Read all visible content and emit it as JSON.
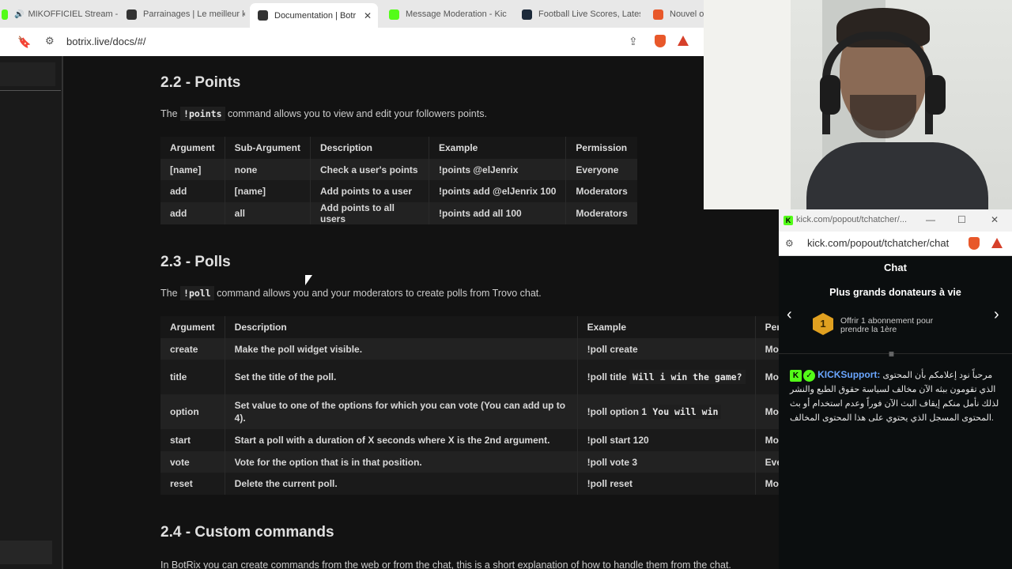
{
  "browser": {
    "tabs": [
      {
        "label": "MIKOFFICIEL Stream -",
        "active": false,
        "favicon_color": "#53fc18"
      },
      {
        "label": "Parrainages | Le meilleur k",
        "active": false,
        "favicon_color": "#333333"
      },
      {
        "label": "Documentation | Botr",
        "active": true,
        "favicon_color": "#333333"
      },
      {
        "label": "Message Moderation - Kic",
        "active": false,
        "favicon_color": "#53fc18"
      },
      {
        "label": "Football Live Scores, Lates",
        "active": false,
        "favicon_color": "#1c2a3a"
      },
      {
        "label": "Nouvel o",
        "active": false,
        "favicon_color": "#e8582a"
      }
    ],
    "close_glyph": "✕",
    "url": "botrix.live/docs/#/",
    "brave_badge": "1"
  },
  "docs": {
    "points": {
      "title": "2.2 - Points",
      "intro_before": "The",
      "intro_code": "!points",
      "intro_after": "command allows you to view and edit your followers points.",
      "headers": [
        "Argument",
        "Sub-Argument",
        "Description",
        "Example",
        "Permission"
      ],
      "rows": [
        [
          "[name]",
          "none",
          "Check a user's points",
          "!points @elJenrix",
          "Everyone"
        ],
        [
          "add",
          "[name]",
          "Add points to a user",
          "!points add @elJenrix 100",
          "Moderators"
        ],
        [
          "add",
          "all",
          "Add points to all users",
          "!points add all 100",
          "Moderators"
        ]
      ]
    },
    "polls": {
      "title": "2.3 - Polls",
      "intro_before": "The",
      "intro_code": "!poll",
      "intro_after": "command allows you and your moderators to create polls from Trovo chat.",
      "headers": [
        "Argument",
        "Description",
        "Example",
        "Per"
      ],
      "rows": [
        {
          "arg": "create",
          "desc": "Make the poll widget visible.",
          "ex": "!poll create",
          "ex_code": "",
          "perm": "Mo"
        },
        {
          "arg": "title",
          "desc": "Set the title of the poll.",
          "ex": "!poll title",
          "ex_code": "Will i win the game?",
          "perm": "Mo"
        },
        {
          "arg": "option",
          "desc": "Set value to one of the options for which you can vote (You can add up to 4).",
          "ex": "!poll option 1",
          "ex_code": "You will win",
          "perm": "Mo"
        },
        {
          "arg": "start",
          "desc": "Start a poll with a duration of X seconds where X is the 2nd argument.",
          "ex": "!poll start 120",
          "ex_code": "",
          "perm": "Mo"
        },
        {
          "arg": "vote",
          "desc": "Vote for the option that is in that position.",
          "ex": "!poll vote 3",
          "ex_code": "",
          "perm": "Eve"
        },
        {
          "arg": "reset",
          "desc": "Delete the current poll.",
          "ex": "!poll reset",
          "ex_code": "",
          "perm": "Mo"
        }
      ]
    },
    "custom": {
      "title": "2.4 - Custom commands",
      "intro": "In BotRix you can create commands from the web or from the chat, this is a short explanation of how to handle them from the chat."
    }
  },
  "popout": {
    "window_title": "kick.com/popout/tchatcher/...",
    "window_controls": [
      "—",
      "☐",
      "✕"
    ],
    "url": "kick.com/popout/tchatcher/chat",
    "chat_title": "Chat",
    "donors_title": "Plus grands donateurs à vie",
    "rank": "1",
    "offer_text": "Offrir 1 abonnement pour prendre la 1ère",
    "message": {
      "username": "KICKSupport",
      "separator": ":",
      "text": "مرحباً نود إعلامكم بأن المحتوى الذي تقومون ببثه الآن مخالف لسياسة حقوق الطبع والنشر لذلك نأمل منكم إيقاف البث الآن فوراً وعدم استخدام أو بث المحتوى المسجل الذي يحتوي على هذا المحتوى المخالف."
    }
  },
  "icons": {
    "bookmark": "bookmark-icon",
    "share": "share-icon",
    "prev": "chevron-left-icon",
    "next": "chevron-right-icon"
  }
}
